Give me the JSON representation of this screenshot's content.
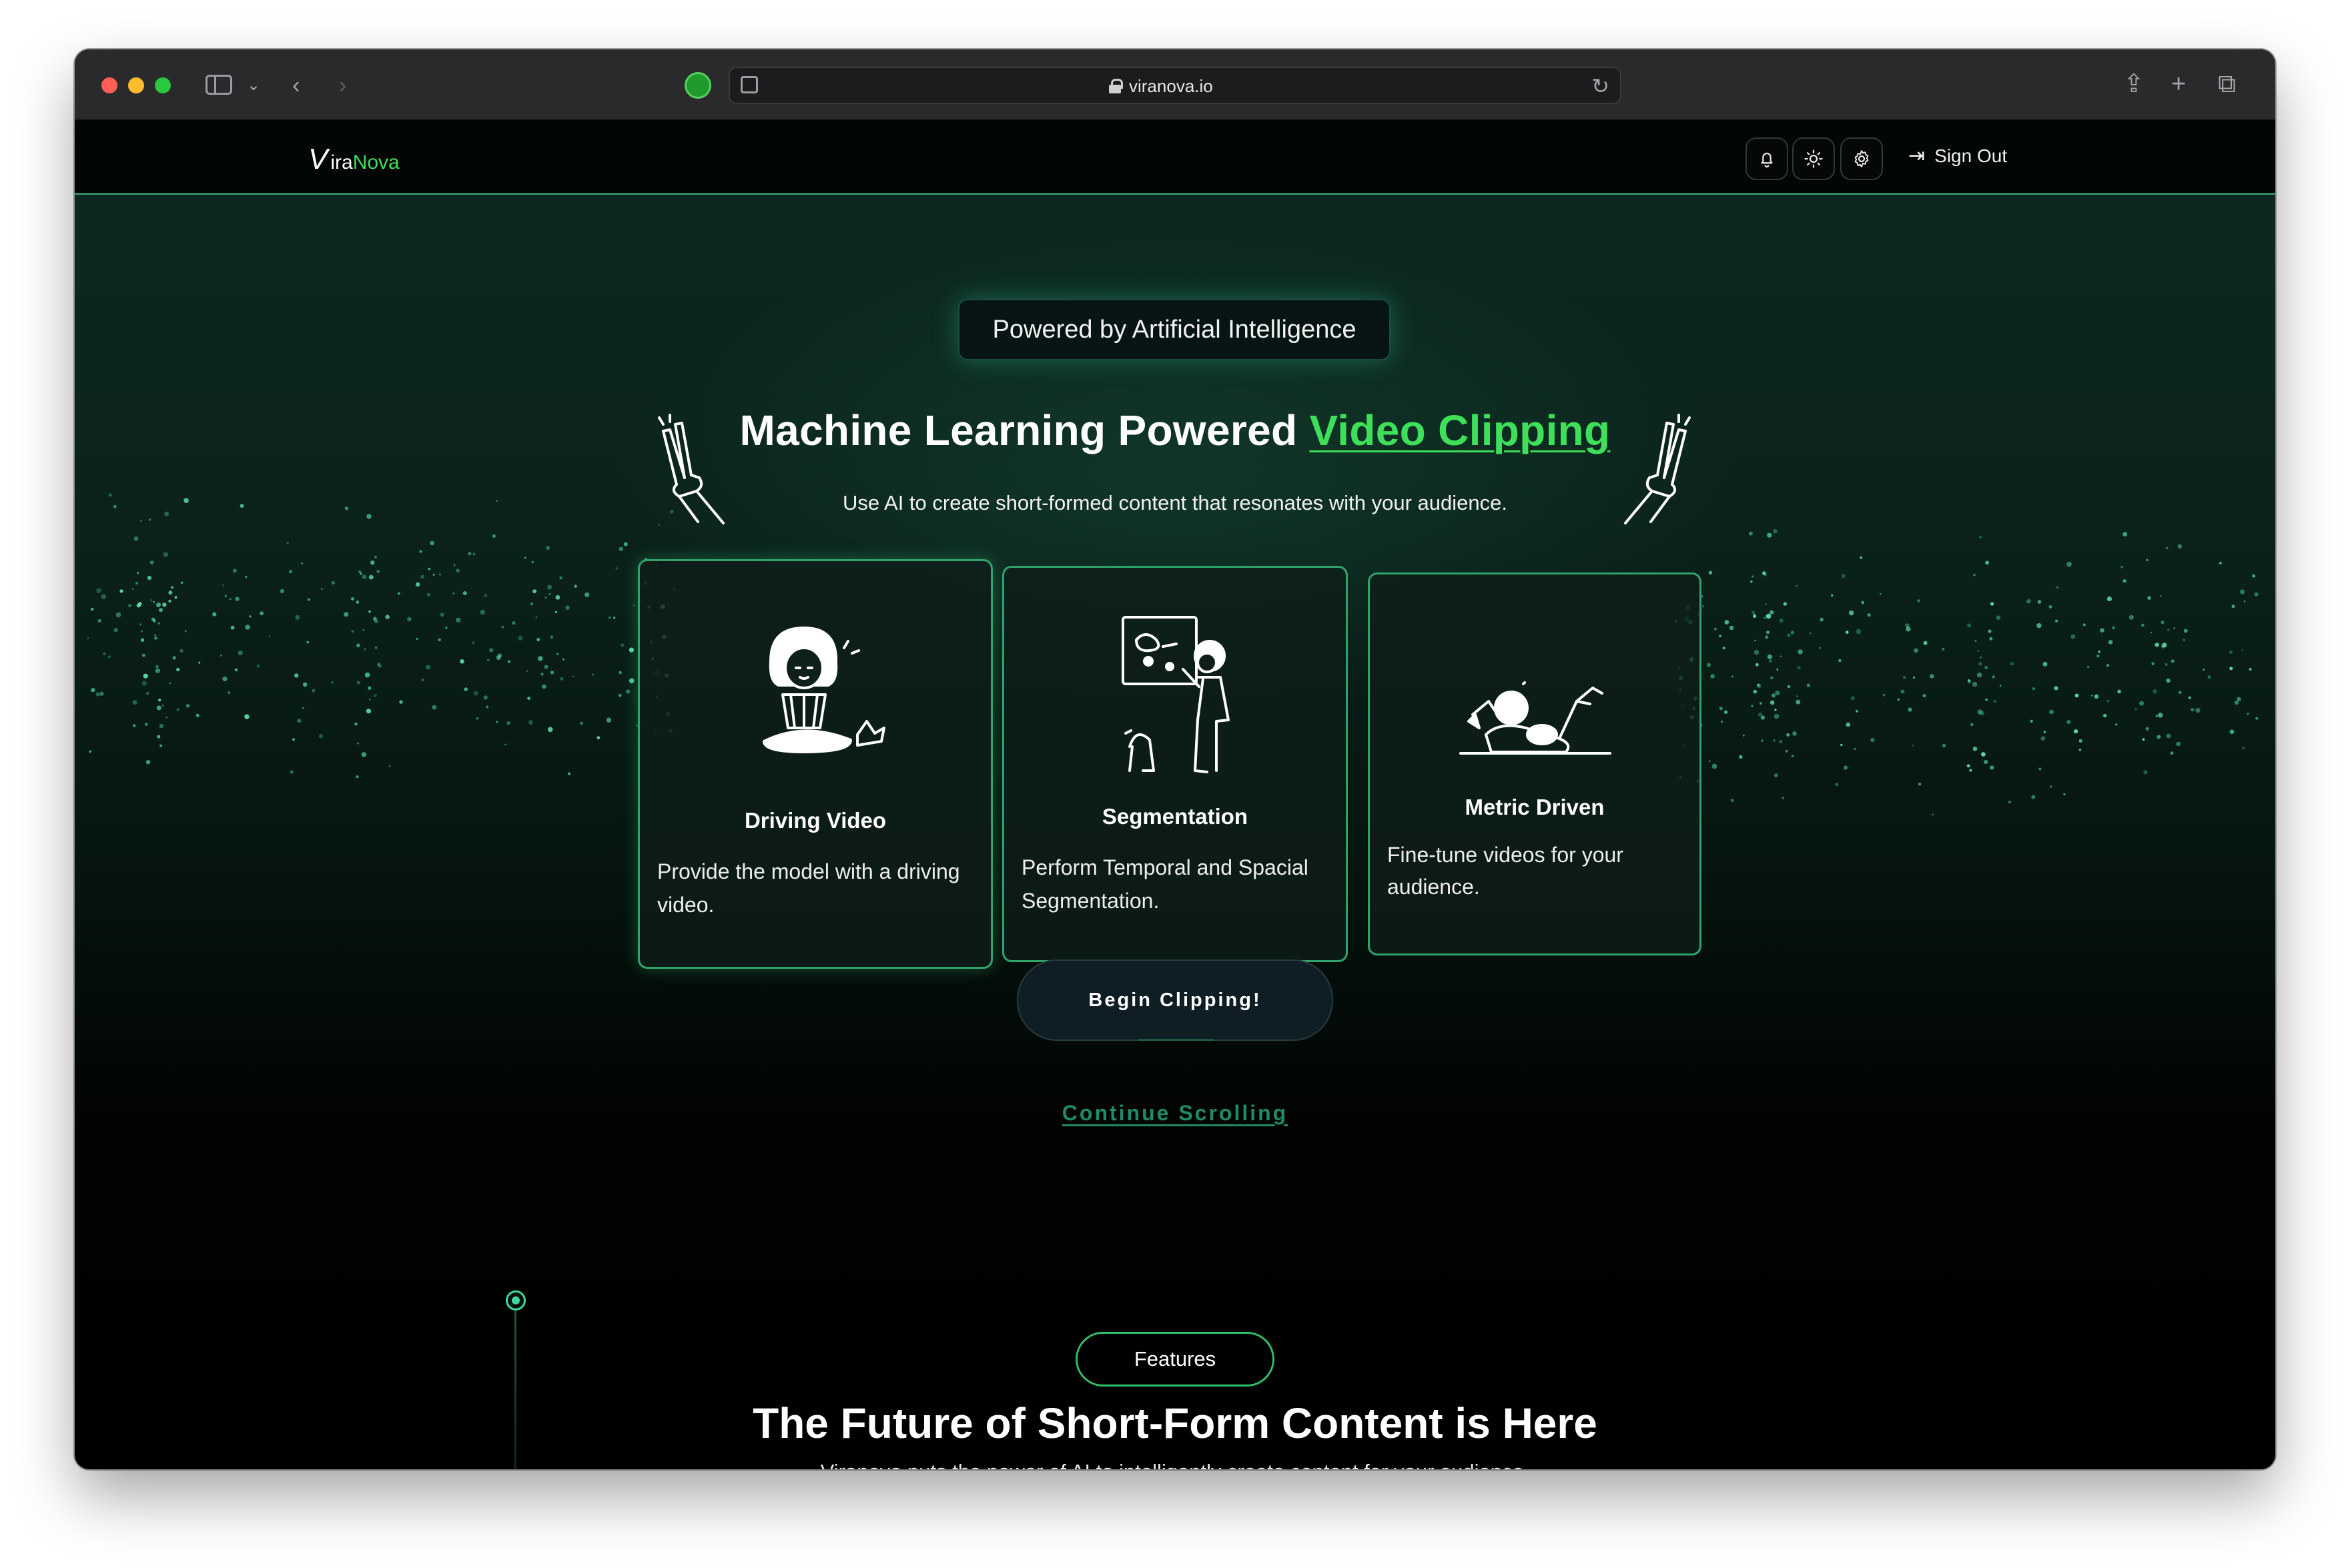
{
  "browser": {
    "url": "viranova.io"
  },
  "nav": {
    "logo_prefix": "ira",
    "logo_suffix": "Nova",
    "sign_out_label": "Sign Out"
  },
  "hero": {
    "badge": "Powered by Artificial Intelligence",
    "title_main": "Machine Learning Powered ",
    "title_accent": "Video Clipping",
    "subtitle": "Use AI to create short-formed content that resonates with your audience."
  },
  "cards": [
    {
      "title": "Driving Video",
      "text": "Provide the model with a driving video."
    },
    {
      "title": "Segmentation",
      "text": "Perform Temporal and Spacial Segmentation."
    },
    {
      "title": "Metric Driven",
      "text": "Fine-tune videos for your audience."
    }
  ],
  "cta": {
    "begin_label": "Begin Clipping!",
    "continue_label": "Continue Scrolling"
  },
  "features": {
    "pill": "Features",
    "title": "The Future of Short-Form Content is Here",
    "subtitle": "Viranova puts the power of AI to intelligently create content for your audience."
  },
  "colors": {
    "accent": "#3ee05a",
    "card_border": "#2fa36b",
    "link": "#1f8a6a"
  },
  "icons": [
    "sidebar-icon",
    "back-icon",
    "forward-icon",
    "lock-icon",
    "reload-icon",
    "share-icon",
    "new-tab-icon",
    "tabs-icon",
    "bell-icon",
    "sun-icon",
    "gear-icon",
    "sign-out-icon"
  ]
}
